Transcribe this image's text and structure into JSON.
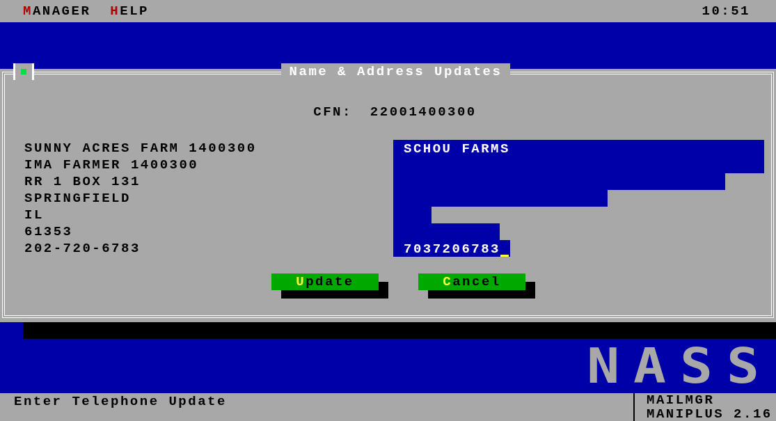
{
  "menu": [
    {
      "hotkey": "M",
      "rest": "ANAGER"
    },
    {
      "hotkey": "H",
      "rest": "ELP"
    }
  ],
  "clock": "10:51",
  "dialog": {
    "title": "Name & Address Updates",
    "cfn_label": "CFN:",
    "cfn_value": "22001400300",
    "current_lines": [
      "SUNNY ACRES FARM 1400300",
      "IMA FARMER 1400300",
      "RR 1 BOX 131",
      "SPRINGFIELD",
      "IL",
      "61353",
      "202-720-6783"
    ],
    "fields": [
      {
        "value": "SCHOU FARMS",
        "focused": false
      },
      {
        "focused": false
      },
      {
        "focused": false
      },
      {
        "focused": false
      },
      {
        "focused": false
      },
      {
        "focused": false
      },
      {
        "value": "7037206783",
        "focused": true
      }
    ],
    "buttons": [
      {
        "hotkey": "U",
        "rest": "pdate"
      },
      {
        "hotkey": "C",
        "rest": "ancel"
      }
    ]
  },
  "logo": "NASS",
  "status_bar": {
    "message": "Enter Telephone Update",
    "program_lines": [
      "MAILMGR",
      "MANIPLUS 2.16"
    ]
  }
}
